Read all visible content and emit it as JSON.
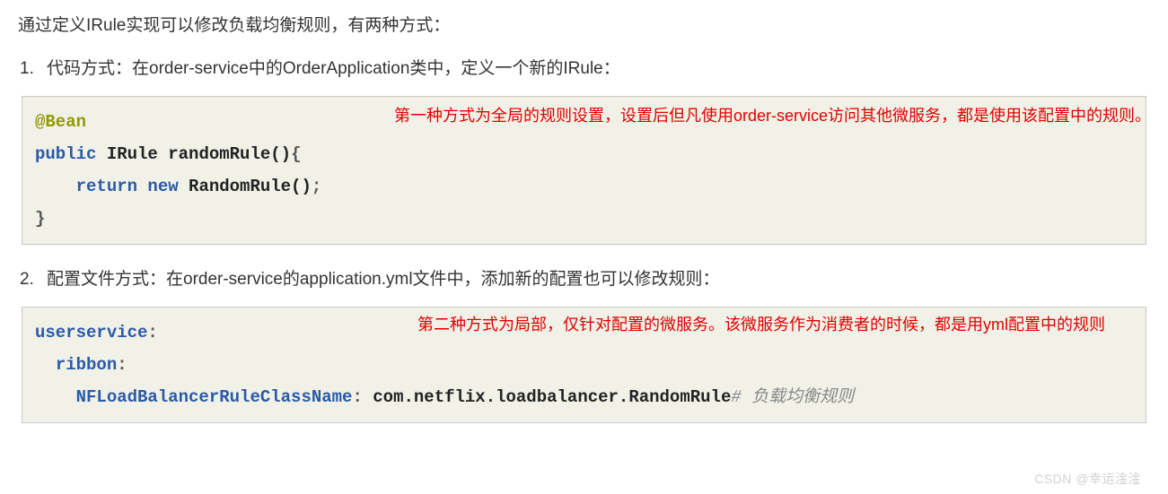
{
  "intro": "通过定义IRule实现可以修改负载均衡规则，有两种方式：",
  "items": [
    {
      "num": "1.",
      "text": "代码方式：在order-service中的OrderApplication类中，定义一个新的IRule："
    },
    {
      "num": "2.",
      "text": "配置文件方式：在order-service的application.yml文件中，添加新的配置也可以修改规则："
    }
  ],
  "code1": {
    "annotation": "@Bean",
    "line2_kw1": "public",
    "line2_type": " IRule randomRule()",
    "line2_brace": "{",
    "line3_kw1": "return",
    "line3_kw2": " new",
    "line3_rest": " RandomRule()",
    "line3_semi": ";",
    "line4": "}",
    "note": "第一种方式为全局的规则设置，设置后但凡使用order-service访问其他微服务，都是使用该配置中的规则。"
  },
  "code2": {
    "l1_key": "userservice",
    "l1_colon": ":",
    "l2_key": "ribbon",
    "l2_colon": ":",
    "l3_key": "NFLoadBalancerRuleClassName",
    "l3_colon": ":",
    "l3_val": " com.netflix.loadbalancer.RandomRule",
    "l3_comment": "# 负载均衡规则",
    "note": "第二种方式为局部，仅针对配置的微服务。该微服务作为消费者的时候，都是用yml配置中的规则"
  },
  "watermark": "CSDN @幸运淦淦"
}
